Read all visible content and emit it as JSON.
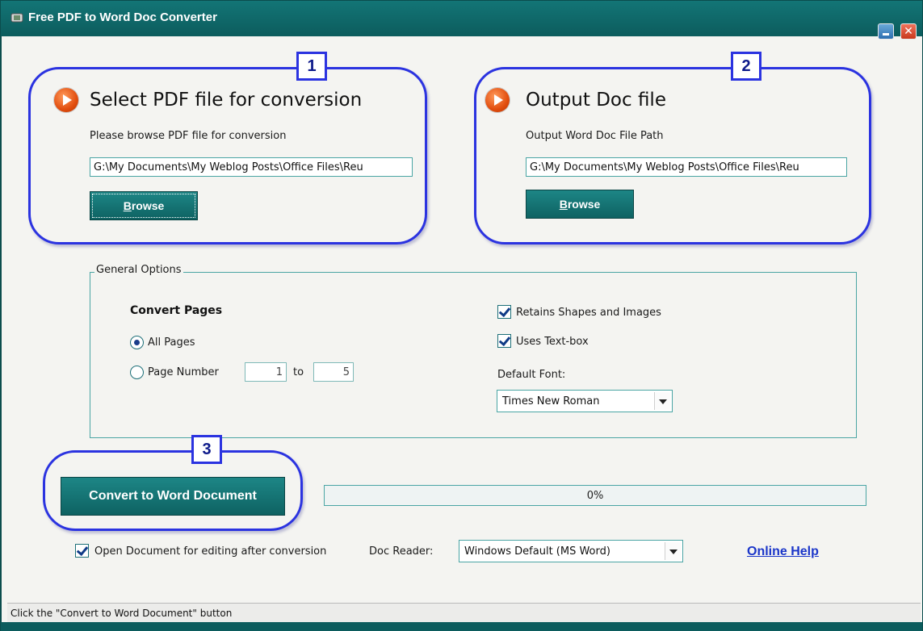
{
  "window": {
    "title": "Free PDF to Word Doc Converter",
    "close_glyph": "✕"
  },
  "colors": {
    "titlebar": "#0f6a6b",
    "accent_teal": "#137576",
    "step_outline": "#2b33e0",
    "link": "#1a35c9"
  },
  "steps": [
    {
      "number": "1",
      "heading": "Select PDF file for conversion",
      "label": "Please browse PDF file for conversion",
      "path_value": "G:\\My Documents\\My Weblog Posts\\Office Files\\Reu",
      "button_label_first": "B",
      "button_label_rest": "rowse"
    },
    {
      "number": "2",
      "heading": "Output Doc file",
      "label": "Output Word Doc File Path",
      "path_value": "G:\\My Documents\\My Weblog Posts\\Office Files\\Reu",
      "button_label_first": "B",
      "button_label_rest": "rowse"
    },
    {
      "number": "3"
    }
  ],
  "options": {
    "legend": "General Options",
    "convert_pages_label": "Convert Pages",
    "radio_all_label": "All Pages",
    "radio_all_checked": true,
    "radio_page_label": "Page Number",
    "radio_page_checked": false,
    "page_from": "1",
    "to_label": "to",
    "page_to": "5",
    "retain_shapes_label": "Retains Shapes and Images",
    "retain_shapes_checked": true,
    "uses_textbox_label": "Uses Text-box",
    "uses_textbox_checked": true,
    "default_font_label": "Default Font:",
    "default_font_value": "Times New Roman"
  },
  "convert": {
    "button_label": "Convert to Word Document",
    "progress_percent": 0,
    "progress_text": "0%"
  },
  "footer_options": {
    "open_doc_label": "Open Document for editing after conversion",
    "open_doc_checked": true,
    "doc_reader_label": "Doc Reader:",
    "doc_reader_value": "Windows Default (MS Word)",
    "help_link": "Online Help"
  },
  "status": {
    "text": "Click the \"Convert to Word Document\" button"
  },
  "icons": {
    "app": "converter-app-icon",
    "step": "play-arrow-icon",
    "minimize": "minimize-icon",
    "close": "close-icon",
    "dropdown": "chevron-down-icon"
  }
}
